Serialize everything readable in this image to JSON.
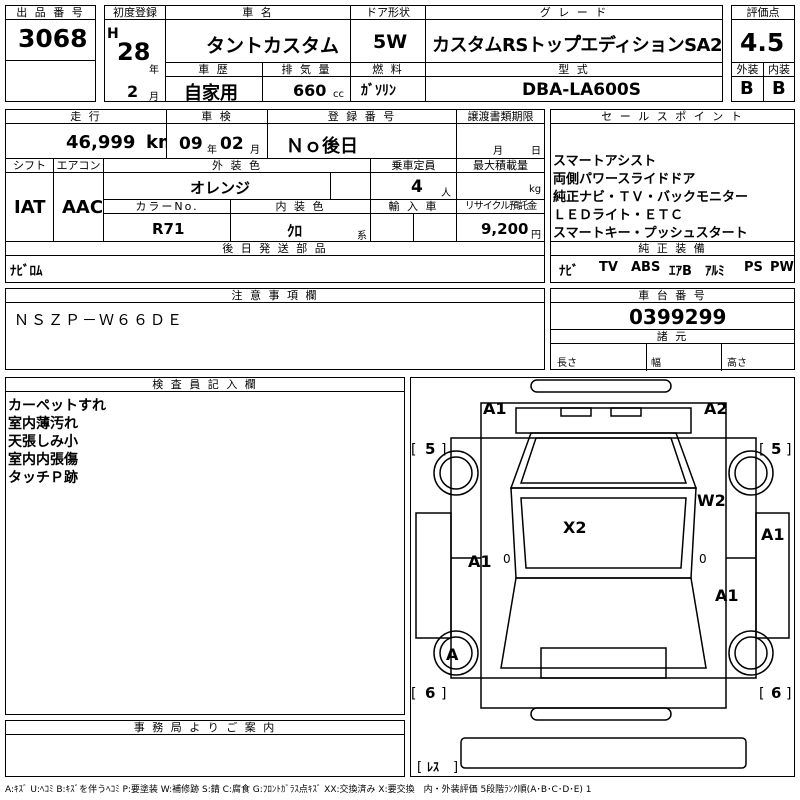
{
  "header": {
    "lot_no_label": "出 品 番 号",
    "lot_no": "3068",
    "first_reg_label": "初度登録",
    "era": "H",
    "year_val": "28",
    "year_unit": "年",
    "month_val": "2",
    "month_unit": "月",
    "car_name_label": "車 名",
    "car_name": "タントカスタム",
    "door_label": "ドア形状",
    "door": "5W",
    "grade_label": "グ レ ー ド",
    "grade": "カスタムRSトップ゚エディションSA2",
    "score_label": "評価点",
    "score": "4.5",
    "history_label": "車 歴",
    "history": "自家用",
    "displacement_label": "排 気 量",
    "displacement": "660",
    "displacement_unit": "cc",
    "fuel_label": "燃 料",
    "fuel": "ｶﾞｿﾘﾝ",
    "model_label": "型 式",
    "model": "DBA-LA600S",
    "ext_label": "外装",
    "ext": "B",
    "int_label": "内装",
    "int": "B"
  },
  "row2": {
    "mileage_label": "走 行",
    "mileage": "46,999",
    "mileage_unit": "km",
    "inspection_label": "車 検",
    "insp_year": "09",
    "insp_year_unit": "年",
    "insp_month": "02",
    "insp_month_unit": "月",
    "reg_no_label": "登 録 番 号",
    "reg_no": "Ｎｏ後日",
    "transfer_label": "譲渡書類期限",
    "transfer_month_unit": "月",
    "transfer_day_unit": "日",
    "shift_label": "シフト",
    "shift": "IAT",
    "ac_label": "エアコン",
    "ac": "AAC",
    "ext_color_label": "外 装 色",
    "ext_color": "オレンジ",
    "capacity_label": "乗車定員",
    "capacity": "4",
    "capacity_unit": "人",
    "load_label": "最大積載量",
    "load_unit": "kg",
    "color_no_label": "カラーNo.",
    "color_no": "R71",
    "int_color_label": "内 装 色",
    "int_color": "ｸﾛ",
    "int_color_unit": "系",
    "import_label": "輸 入 車",
    "recycle_label": "リサイクル預託金",
    "recycle": "9,200",
    "recycle_unit": "円",
    "later_parts_label": "後 日 発 送 部 品",
    "later_parts": "ﾅﾋﾞﾛﾑ"
  },
  "sales": {
    "label": "セ ー ル ス ポ イ ン ト",
    "points": [
      "スマートアシスト",
      "両側パワースライドドア",
      "純正ナビ・ＴＶ・バックモニター",
      "ＬＥＤライト・ＥＴＣ",
      "スマートキー・プッシュスタート"
    ],
    "equip_label": "純 正 装 備",
    "equip": [
      "ﾅﾋﾞ",
      "TV",
      "ABS",
      "ｴｱB",
      "ｱﾙﾐ",
      "PS",
      "PW"
    ]
  },
  "notes": {
    "label": "注 意 事 項 欄",
    "text": "ＮＳＺＰ－Ｗ６６ＤＥ"
  },
  "chassis": {
    "label": "車 台 番 号",
    "no": "0399299",
    "spec_label": "諸 元",
    "length_label": "長さ",
    "width_label": "幅",
    "height_label": "高さ"
  },
  "inspector": {
    "label": "検 査 員 記 入 欄",
    "lines": [
      "カーペットすれ",
      "室内薄汚れ",
      "天張しみ小",
      "室内内張傷",
      "タッチＰ跡"
    ]
  },
  "office": {
    "label": "事 務 局 よ り ご 案 内"
  },
  "diagram": {
    "marks": {
      "a1_fl": "A1",
      "a2_fr": "A2",
      "w2": "W2",
      "x2": "X2",
      "a1_left": "A1",
      "a1_right_front": "A1",
      "a1_right": "A1",
      "a_rear": "A"
    },
    "tire_fl": "5",
    "tire_fr": "5",
    "tire_rl": "6",
    "tire_rr": "6",
    "spare": "ﾚｽ",
    "zero": "0"
  },
  "legend": "A:ｷｽﾞ U:ﾍｺﾐ B:ｷｽﾞを伴うﾍｺﾐ P:要塗装 W:補修跡 S:錆 C:腐食 G:ﾌﾛﾝﾄｶﾞﾗｽ点ｷｽﾞ XX:交換済み X:要交換　内・外装評価 5段階ﾗﾝｸ順(A･B･C･D･E) 1"
}
